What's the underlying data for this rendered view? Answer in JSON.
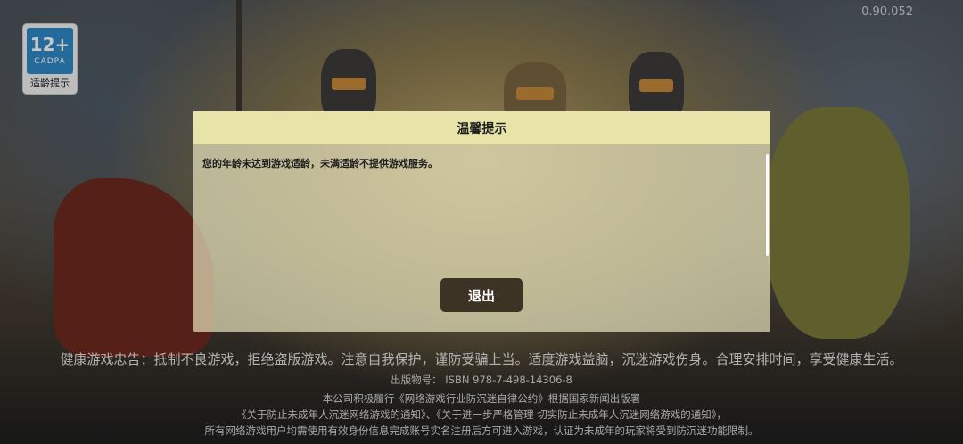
{
  "version": "0.90.052",
  "age_badge": {
    "rating": "12+",
    "org": "CADPA",
    "tip": "适龄提示"
  },
  "dialog": {
    "title": "温馨提示",
    "message": "您的年龄未达到游戏适龄，未满适龄不提供游戏服务。",
    "exit_label": "退出"
  },
  "notices": {
    "health": "健康游戏忠告：抵制不良游戏，拒绝盗版游戏。注意自我保护，谨防受骗上当。适度游戏益脑，沉迷游戏伤身。合理安排时间，享受健康生活。",
    "isbn": "出版物号： ISBN 978-7-498-14306-8",
    "line1": "本公司积极履行《网络游戏行业防沉迷自律公约》根据国家新闻出版署",
    "line2": "《关于防止未成年人沉迷网络游戏的通知》、《关于进一步严格管理 切实防止未成年人沉迷网络游戏的通知》，",
    "line3": "所有网络游戏用户均需使用有效身份信息完成账号实名注册后方可进入游戏，认证为未成年的玩家将受到防沉迷功能限制。"
  }
}
